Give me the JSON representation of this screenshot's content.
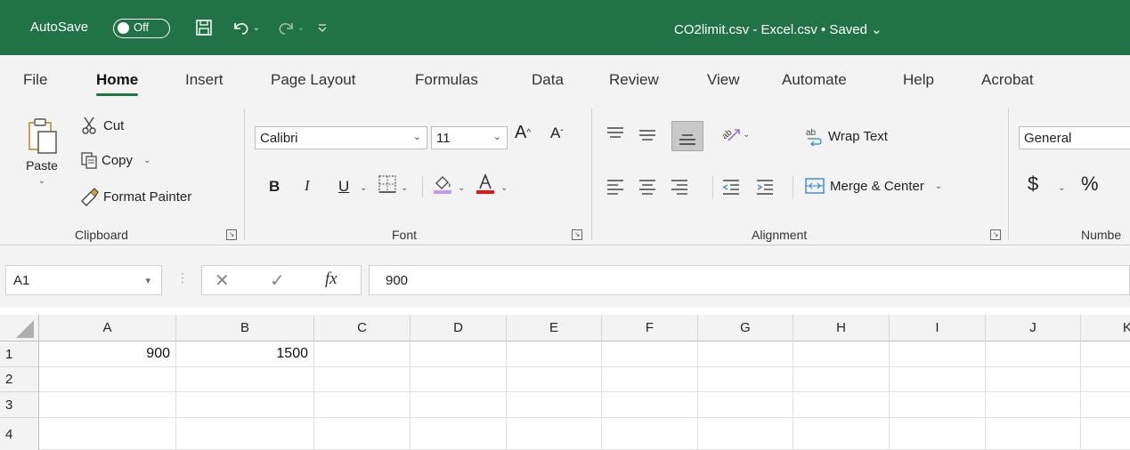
{
  "titlebar": {
    "autosave_label": "AutoSave",
    "autosave_state": "Off",
    "document_title": "CO2limit.csv - Excel.csv • Saved ⌄",
    "accent_color": "#217346"
  },
  "tabs": [
    "File",
    "Home",
    "Insert",
    "Page Layout",
    "Formulas",
    "Data",
    "Review",
    "View",
    "Automate",
    "Help",
    "Acrobat"
  ],
  "active_tab": "Home",
  "ribbon": {
    "clipboard": {
      "paste": "Paste",
      "cut": "Cut",
      "copy": "Copy",
      "format_painter": "Format Painter",
      "label": "Clipboard"
    },
    "font": {
      "font_name": "Calibri",
      "font_size": "11",
      "bold": "B",
      "italic": "I",
      "underline": "U",
      "label": "Font"
    },
    "alignment": {
      "wrap_text": "Wrap Text",
      "merge_center": "Merge & Center",
      "label": "Alignment"
    },
    "number": {
      "format": "General",
      "currency": "$",
      "percent": "%",
      "label": "Numbe"
    }
  },
  "formula_bar": {
    "name_box": "A1",
    "fx": "fx",
    "value": "900"
  },
  "grid": {
    "columns": [
      "A",
      "B",
      "C",
      "D",
      "E",
      "F",
      "G",
      "H",
      "I",
      "J",
      "K"
    ],
    "rows": [
      "1",
      "2",
      "3",
      "4"
    ],
    "cells": {
      "A1": "900",
      "B1": "1500"
    }
  }
}
